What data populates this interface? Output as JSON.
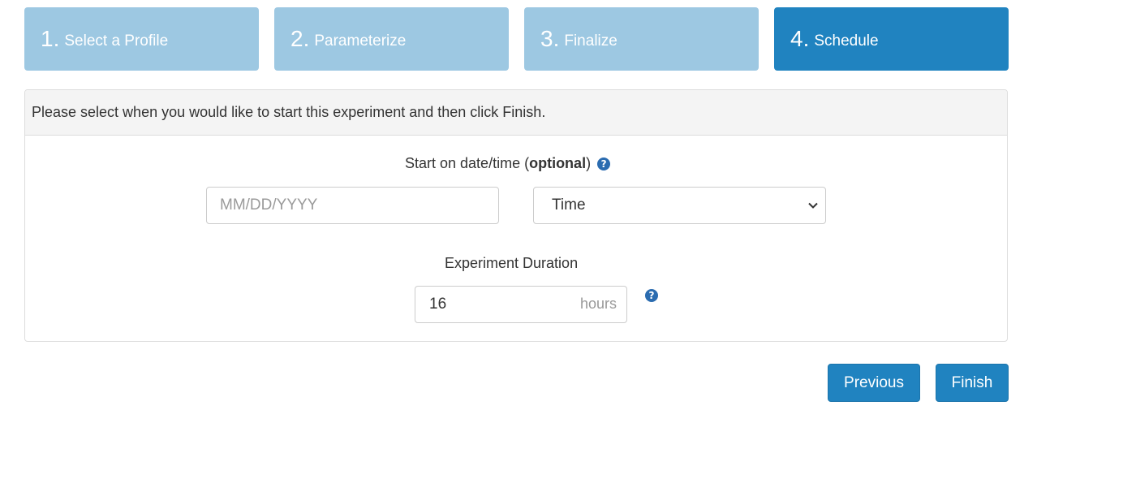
{
  "wizard": {
    "steps": [
      {
        "number": "1.",
        "label": "Select a Profile",
        "active": false
      },
      {
        "number": "2.",
        "label": "Parameterize",
        "active": false
      },
      {
        "number": "3.",
        "label": "Finalize",
        "active": false
      },
      {
        "number": "4.",
        "label": "Schedule",
        "active": true
      }
    ],
    "colors": {
      "inactive": "#9dc8e2",
      "active": "#2083c0"
    }
  },
  "panel": {
    "heading": "Please select when you would like to start this experiment and then click Finish.",
    "start": {
      "label_prefix": "Start on date/time (",
      "label_bold": "optional",
      "label_suffix": ")",
      "help_icon": "question-circle-icon",
      "date_placeholder": "MM/DD/YYYY",
      "time_selected": "Time"
    },
    "duration": {
      "label": "Experiment Duration",
      "value": "16",
      "unit": "hours",
      "help_icon": "question-circle-icon"
    }
  },
  "actions": {
    "previous_label": "Previous",
    "finish_label": "Finish"
  }
}
